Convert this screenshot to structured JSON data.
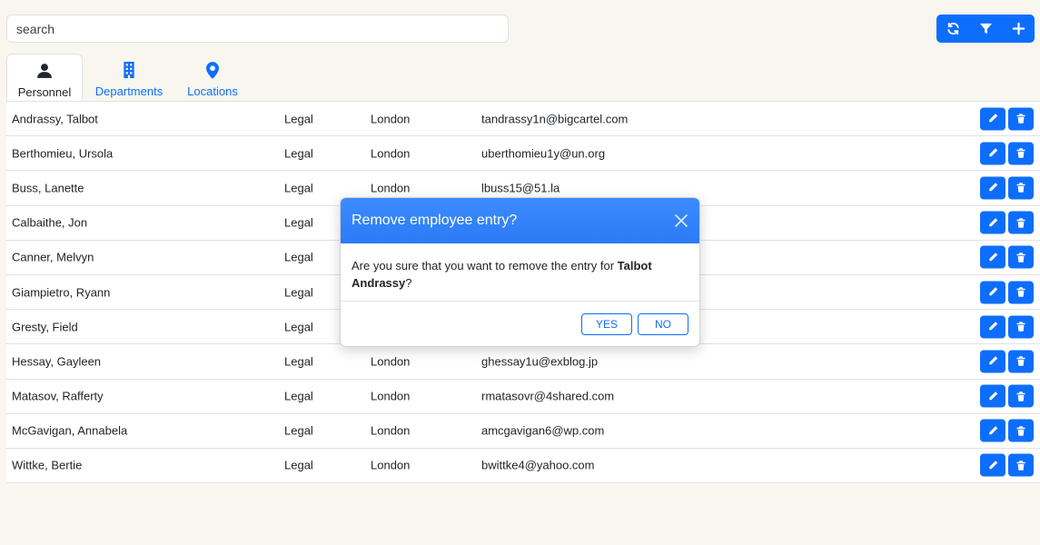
{
  "search": {
    "placeholder": "search",
    "value": ""
  },
  "toolbar": {
    "icons": [
      "refresh-icon",
      "filter-icon",
      "plus-icon"
    ]
  },
  "tabs": [
    {
      "label": "Personnel",
      "icon": "person-icon",
      "active": true
    },
    {
      "label": "Departments",
      "icon": "building-icon",
      "active": false
    },
    {
      "label": "Locations",
      "icon": "map-pin-icon",
      "active": false
    }
  ],
  "rows": [
    {
      "name": "Andrassy, Talbot",
      "department": "Legal",
      "location": "London",
      "email": "tandrassy1n@bigcartel.com"
    },
    {
      "name": "Berthomieu, Ursola",
      "department": "Legal",
      "location": "London",
      "email": "uberthomieu1y@un.org"
    },
    {
      "name": "Buss, Lanette",
      "department": "Legal",
      "location": "London",
      "email": "lbuss15@51.la"
    },
    {
      "name": "Calbaithe, Jon",
      "department": "Legal",
      "location": "",
      "email": ""
    },
    {
      "name": "Canner, Melvyn",
      "department": "Legal",
      "location": "",
      "email": ""
    },
    {
      "name": "Giampietro, Ryann",
      "department": "Legal",
      "location": "",
      "email": ""
    },
    {
      "name": "Gresty, Field",
      "department": "Legal",
      "location": "",
      "email": ""
    },
    {
      "name": "Hessay, Gayleen",
      "department": "Legal",
      "location": "London",
      "email": "ghessay1u@exblog.jp"
    },
    {
      "name": "Matasov, Rafferty",
      "department": "Legal",
      "location": "London",
      "email": "rmatasovr@4shared.com"
    },
    {
      "name": "McGavigan, Annabela",
      "department": "Legal",
      "location": "London",
      "email": "amcgavigan6@wp.com"
    },
    {
      "name": "Wittke, Bertie",
      "department": "Legal",
      "location": "London",
      "email": "bwittke4@yahoo.com"
    }
  ],
  "modal": {
    "title": "Remove employee entry?",
    "message_prefix": "Are you sure that you want to remove the entry for ",
    "message_name": "Talbot Andrassy",
    "message_suffix": "?",
    "yes_label": "YES",
    "no_label": "NO"
  },
  "colors": {
    "primary": "#0d6efd",
    "background": "#f8f6ee"
  }
}
